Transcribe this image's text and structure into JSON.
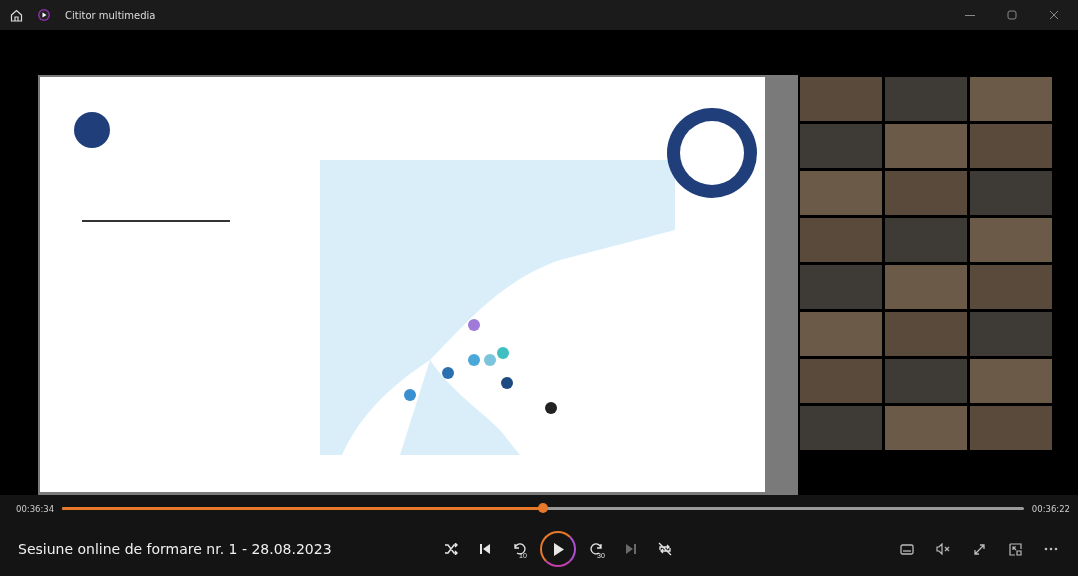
{
  "window": {
    "title": "Cititor multimedia"
  },
  "playback": {
    "elapsed": "00:36:34",
    "remaining": "00:36:22",
    "level": 0.5,
    "playing": false
  },
  "media_title": "Sesiune online de formare nr. 1 - 28.08.2023",
  "controls": [
    {
      "kind": "shuffle",
      "disabled": false
    },
    {
      "kind": "previous",
      "disabled": false
    },
    {
      "kind": "rewind",
      "label": "10",
      "disabled": false
    },
    {
      "kind": "play",
      "disabled": false
    },
    {
      "kind": "forward",
      "label": "30",
      "disabled": false
    },
    {
      "kind": "next",
      "disabled": true
    },
    {
      "kind": "repeat",
      "disabled": false
    }
  ],
  "options": [
    {
      "kind": "captions"
    },
    {
      "kind": "mute"
    },
    {
      "kind": "fullscreen"
    },
    {
      "kind": "miniplayer"
    },
    {
      "kind": "more"
    }
  ]
}
